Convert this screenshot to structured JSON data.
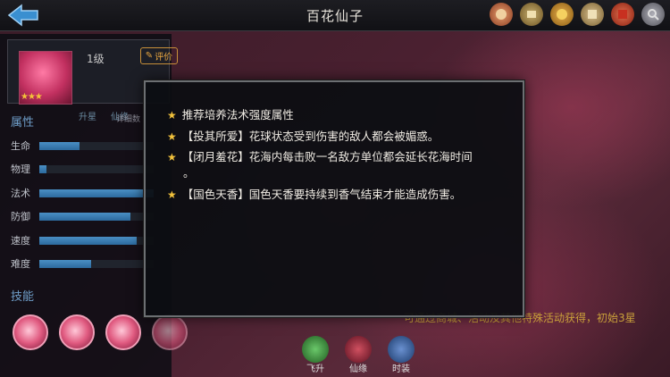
{
  "header": {
    "title": "百花仙子"
  },
  "hero": {
    "level": "1级",
    "rate_label": "评价",
    "stars": "★★★",
    "btn_upgrade": "升星",
    "btn_fairy": "仙缘"
  },
  "attributes": {
    "section_title": "属性",
    "detail_label": "详细数",
    "stats": [
      {
        "name": "生命",
        "fill": 0.35
      },
      {
        "name": "物理",
        "fill": 0.06
      },
      {
        "name": "法术",
        "fill": 1.0
      },
      {
        "name": "防御",
        "fill": 0.8
      },
      {
        "name": "速度",
        "fill": 0.85
      },
      {
        "name": "难度",
        "fill": 0.45
      }
    ]
  },
  "skills": {
    "section_title": "技能"
  },
  "bottom_tabs": [
    {
      "label": "飞升",
      "color": "#3a8a3a"
    },
    {
      "label": "仙缘",
      "color": "#8a2a3a"
    },
    {
      "label": "时装",
      "color": "#3a5a8a"
    }
  ],
  "background_note": "可通过商城、活动及其他特殊活动获得，初始3星",
  "dialog": {
    "tips": [
      "推荐培养法术强度属性",
      "【投其所爱】花球状态受到伤害的敌人都会被媚惑。",
      "【闭月羞花】花海内每击败一名敌方单位都会延长花海时间",
      "。",
      "【国色天香】国色天香要持续到香气结束才能造成伤害。"
    ]
  },
  "colors": {
    "accent_blue": "#6f9ec9",
    "star_gold": "#f2c23c",
    "bar_fill": "#3a7fb5"
  }
}
